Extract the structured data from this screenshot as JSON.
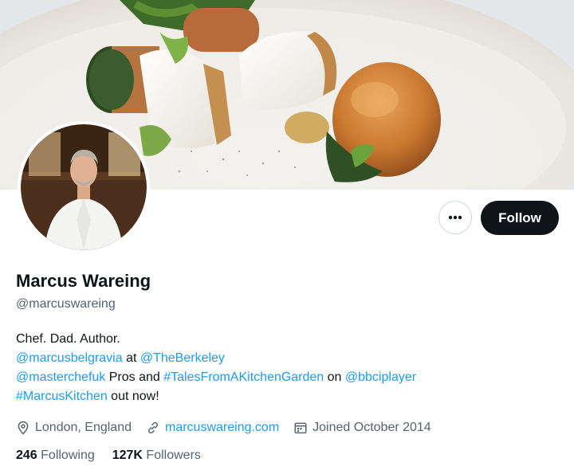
{
  "profile": {
    "name": "Marcus Wareing",
    "handle": "@marcuswareing",
    "bio": {
      "line1": "Chef. Dad. Author.",
      "line2": {
        "mention1": "@marcusbelgravia",
        "text1": " at ",
        "mention2": "@TheBerkeley"
      },
      "line3": {
        "mention1": "@masterchefuk",
        "text1": " Pros and ",
        "hashtag1": "#TalesFromAKitchenGarden",
        "text2": " on ",
        "mention2": "@bbciplayer"
      },
      "line4": {
        "hashtag1": "#MarcusKitchen",
        "text1": " out now!"
      }
    },
    "location": "London, England",
    "website": "marcuswareing.com",
    "joined": "Joined October 2014",
    "following_count": "246",
    "following_label": " Following",
    "followers_count": "127K",
    "followers_label": " Followers"
  },
  "actions": {
    "follow_label": "Follow",
    "more_icon": "ellipsis-icon"
  },
  "colors": {
    "accent": "#1d9bf0",
    "text": "#0f1419",
    "muted": "#536471",
    "follow_bg": "#0f1419"
  }
}
